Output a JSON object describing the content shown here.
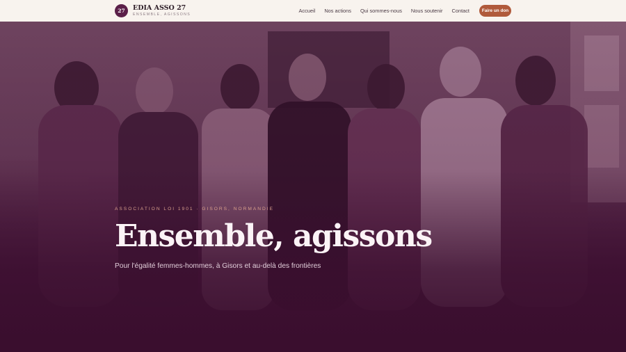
{
  "header": {
    "badge": "27",
    "brand_name": "EDIA ASSO 27",
    "brand_tagline": "ENSEMBLE, AGISSONS",
    "nav": [
      "Accueil",
      "Nos actions",
      "Qui sommes-nous",
      "Nous soutenir",
      "Contact"
    ],
    "donate_label": "Faire un don"
  },
  "hero": {
    "eyebrow": "ASSOCIATION LOI 1901 · GISORS, NORMANDIE",
    "headline": "Ensemble, agissons",
    "subline": "Pour l'égalité femmes-hommes, à Gisors et au-delà des frontières"
  },
  "colors": {
    "header_bg": "#f8f3ee",
    "accent": "#b05a3b",
    "brand": "#5a1e48",
    "hero_overlay": "#3b1230"
  }
}
